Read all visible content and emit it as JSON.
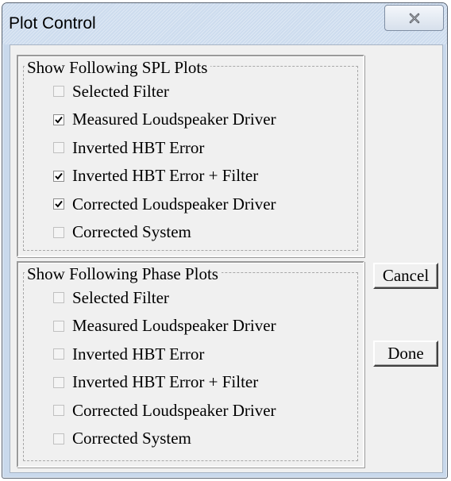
{
  "window": {
    "title": "Plot Control",
    "close_icon": "close-x-icon"
  },
  "spl_group": {
    "title": "Show Following SPL Plots",
    "items": [
      {
        "label": "Selected Filter",
        "checked": false,
        "enabled": false
      },
      {
        "label": "Measured Loudspeaker Driver",
        "checked": true,
        "enabled": true
      },
      {
        "label": "Inverted HBT Error",
        "checked": false,
        "enabled": false
      },
      {
        "label": "Inverted HBT Error + Filter",
        "checked": true,
        "enabled": true
      },
      {
        "label": "Corrected Loudspeaker Driver",
        "checked": true,
        "enabled": true
      },
      {
        "label": "Corrected System",
        "checked": false,
        "enabled": false
      }
    ]
  },
  "phase_group": {
    "title": "Show Following Phase Plots",
    "items": [
      {
        "label": "Selected Filter",
        "checked": false,
        "enabled": false
      },
      {
        "label": "Measured Loudspeaker Driver",
        "checked": false,
        "enabled": false
      },
      {
        "label": "Inverted HBT Error",
        "checked": false,
        "enabled": false
      },
      {
        "label": "Inverted HBT Error + Filter",
        "checked": false,
        "enabled": false
      },
      {
        "label": "Corrected Loudspeaker Driver",
        "checked": false,
        "enabled": false
      },
      {
        "label": "Corrected System",
        "checked": false,
        "enabled": false
      }
    ]
  },
  "buttons": {
    "cancel_label": "Cancel",
    "done_label": "Done"
  }
}
